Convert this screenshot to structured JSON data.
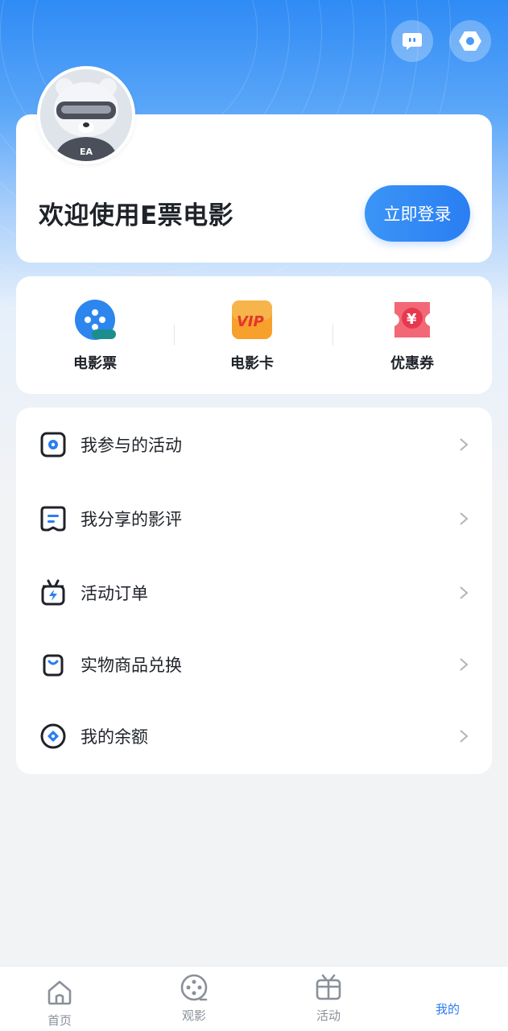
{
  "header": {
    "message_icon": "chat-bubble-icon",
    "settings_icon": "settings-icon"
  },
  "login_card": {
    "avatar": "mascot-avatar",
    "welcome_text": "欢迎使用E票电影",
    "login_button": "立即登录"
  },
  "quick_actions": [
    {
      "label": "电影票",
      "icon": "film-ticket-icon"
    },
    {
      "label": "电影卡",
      "icon": "vip-card-icon"
    },
    {
      "label": "优惠券",
      "icon": "coupon-icon"
    }
  ],
  "menu": [
    {
      "label": "我参与的活动",
      "icon": "activity-icon"
    },
    {
      "label": "我分享的影评",
      "icon": "review-icon"
    },
    {
      "label": "活动订单",
      "icon": "order-icon"
    },
    {
      "label": "实物商品兑换",
      "icon": "bag-icon"
    },
    {
      "label": "我的余额",
      "icon": "balance-icon"
    }
  ],
  "tabbar": [
    {
      "label": "首页",
      "icon": "home-icon",
      "active": false
    },
    {
      "label": "观影",
      "icon": "film-reel-icon",
      "active": false
    },
    {
      "label": "活动",
      "icon": "gift-icon",
      "active": false
    },
    {
      "label": "我的",
      "icon": "profile-icon",
      "active": true
    }
  ],
  "colors": {
    "accent": "#2a7ef2",
    "header_top": "#2f8bf5",
    "inactive_tab": "#8a9099"
  }
}
